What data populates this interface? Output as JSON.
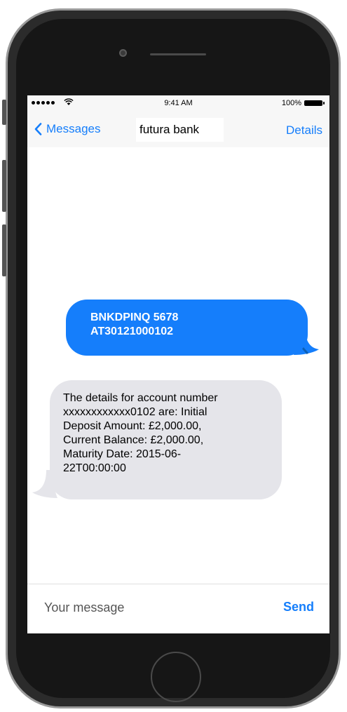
{
  "status_bar": {
    "time": "9:41 AM",
    "battery": "100%"
  },
  "nav": {
    "back_label": "Messages",
    "title": "futura bank",
    "details_label": "Details"
  },
  "messages": [
    {
      "direction": "outgoing",
      "text": "BNKDPINQ 5678\nAT30121000102"
    },
    {
      "direction": "incoming",
      "text": "The details for account number\nxxxxxxxxxxxx0102 are: Initial\nDeposit Amount: £2,000.00,\nCurrent Balance: £2,000.00,\nMaturity Date: 2015-06-\n22T00:00:00"
    }
  ],
  "composer": {
    "placeholder": "Your message",
    "send_label": "Send"
  },
  "colors": {
    "accent": "#157efb",
    "incoming_bubble": "#e5e5ea",
    "outgoing_bubble": "#157efb"
  }
}
